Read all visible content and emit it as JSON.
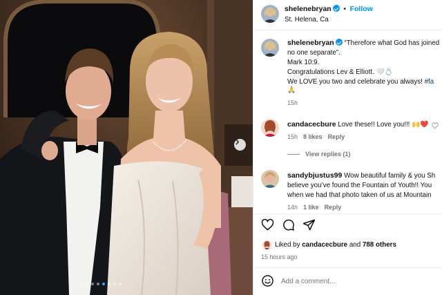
{
  "header": {
    "username": "shelenebryan",
    "follow_label": "Follow",
    "location": "St. Helena, Ca"
  },
  "caption": {
    "username": "shelenebryan",
    "line1": "“Therefore what God has joined",
    "line2": "no one separate”.",
    "line3": "Mark 10:9.",
    "line4": "Congratulations Lev & Elliott. 🤍💍",
    "line5": "We LOVE you two and celebrate you always! ",
    "line5_tag": "#fa",
    "line6": "🙏",
    "time": "15h"
  },
  "comments": [
    {
      "username": "candacecbure",
      "text": "Love these!! Love you!!! 🙌❤️",
      "time": "15h",
      "likes": "8 likes",
      "reply": "Reply",
      "view_replies": "View replies (1)"
    },
    {
      "username": "sandybjustus99",
      "line1": "Wow beautiful family & you Sh",
      "line2": "believe you’ve found the Fountain of Youth!! You",
      "line3": "when we had that photo taken of us at Mountain",
      "time": "14h",
      "likes": "1 like",
      "reply": "Reply"
    }
  ],
  "likes_summary": {
    "prefix": "Liked by ",
    "user": "candacecbure",
    "middle": " and ",
    "others": "788 others"
  },
  "post_time": "15 hours ago",
  "add_comment_placeholder": "Add a comment...",
  "carousel": {
    "count": 8,
    "active_index": 4
  },
  "colors": {
    "accent": "#0095f6",
    "verified": "#0095f6",
    "active_dot": "#38a8f0"
  }
}
